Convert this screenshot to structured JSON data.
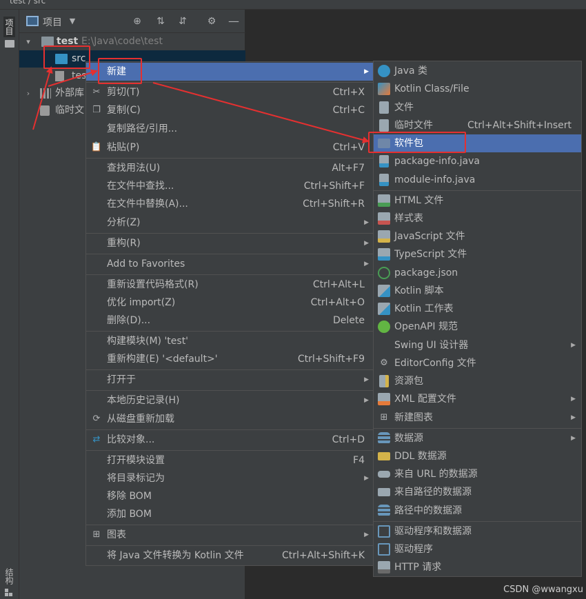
{
  "breadcrumb": {
    "project": "test",
    "folder": "src"
  },
  "left_strip": {
    "project_tab": "项目",
    "structure_tab": "结构"
  },
  "project_panel": {
    "title": "项目",
    "tree": {
      "root": {
        "name": "test",
        "path": "E:\\Java\\code\\test"
      },
      "src": "src",
      "iml": "tes",
      "external_libs": "外部库",
      "scratches": "临时文"
    }
  },
  "context_menu": [
    {
      "label": "新建",
      "shortcut": "",
      "submenu": true,
      "highlighted": true
    },
    {
      "label": "剪切(T)",
      "shortcut": "Ctrl+X",
      "icon": "scissors-icon"
    },
    {
      "label": "复制(C)",
      "shortcut": "Ctrl+C",
      "icon": "copy-icon"
    },
    {
      "label": "复制路径/引用...",
      "shortcut": ""
    },
    {
      "label": "粘贴(P)",
      "shortcut": "Ctrl+V",
      "icon": "paste-icon"
    },
    {
      "label": "查找用法(U)",
      "shortcut": "Alt+F7"
    },
    {
      "label": "在文件中查找...",
      "shortcut": "Ctrl+Shift+F"
    },
    {
      "label": "在文件中替换(A)...",
      "shortcut": "Ctrl+Shift+R"
    },
    {
      "label": "分析(Z)",
      "shortcut": "",
      "submenu": true
    },
    {
      "label": "重构(R)",
      "shortcut": "",
      "submenu": true
    },
    {
      "label": "Add to Favorites",
      "shortcut": "",
      "submenu": true
    },
    {
      "label": "重新设置代码格式(R)",
      "shortcut": "Ctrl+Alt+L"
    },
    {
      "label": "优化 import(Z)",
      "shortcut": "Ctrl+Alt+O"
    },
    {
      "label": "删除(D)...",
      "shortcut": "Delete"
    },
    {
      "label": "构建模块(M) 'test'",
      "shortcut": ""
    },
    {
      "label": "重新构建(E) '<default>'",
      "shortcut": "Ctrl+Shift+F9"
    },
    {
      "label": "打开于",
      "shortcut": "",
      "submenu": true
    },
    {
      "label": "本地历史记录(H)",
      "shortcut": "",
      "submenu": true
    },
    {
      "label": "从磁盘重新加载",
      "shortcut": "",
      "icon": "reload-icon"
    },
    {
      "label": "比较对象...",
      "shortcut": "Ctrl+D",
      "icon": "compare-icon"
    },
    {
      "label": "打开模块设置",
      "shortcut": "F4"
    },
    {
      "label": "将目录标记为",
      "shortcut": "",
      "submenu": true
    },
    {
      "label": "移除 BOM",
      "shortcut": ""
    },
    {
      "label": "添加 BOM",
      "shortcut": ""
    },
    {
      "label": "图表",
      "shortcut": "",
      "submenu": true,
      "icon": "diagram-icon"
    },
    {
      "label": "将 Java 文件转换为 Kotlin 文件",
      "shortcut": "Ctrl+Alt+Shift+K"
    }
  ],
  "new_submenu": [
    {
      "label": "Java 类",
      "icon": "java-class-icon"
    },
    {
      "label": "Kotlin Class/File",
      "icon": "kotlin-class-icon"
    },
    {
      "label": "文件",
      "icon": "file-icon"
    },
    {
      "label": "临时文件",
      "shortcut": "Ctrl+Alt+Shift+Insert",
      "icon": "scratch-file-icon"
    },
    {
      "label": "软件包",
      "highlighted": true,
      "icon": "package-icon"
    },
    {
      "label": "package-info.java",
      "icon": "java-file-icon"
    },
    {
      "label": "module-info.java",
      "icon": "java-file-icon"
    },
    {
      "label": "HTML 文件",
      "icon": "html-icon"
    },
    {
      "label": "样式表",
      "icon": "css-icon"
    },
    {
      "label": "JavaScript 文件",
      "icon": "js-icon"
    },
    {
      "label": "TypeScript 文件",
      "icon": "ts-icon"
    },
    {
      "label": "package.json",
      "icon": "nodejs-icon"
    },
    {
      "label": "Kotlin 脚本",
      "icon": "kotlin-script-icon"
    },
    {
      "label": "Kotlin 工作表",
      "icon": "kotlin-worksheet-icon"
    },
    {
      "label": "OpenAPI 规范",
      "icon": "openapi-icon"
    },
    {
      "label": "Swing UI 设计器",
      "submenu": true
    },
    {
      "label": "EditorConfig 文件",
      "icon": "gear-icon"
    },
    {
      "label": "资源包",
      "icon": "resource-bundle-icon"
    },
    {
      "label": "XML 配置文件",
      "submenu": true,
      "icon": "xml-icon"
    },
    {
      "label": "新建图表",
      "submenu": true,
      "icon": "diagram-icon"
    },
    {
      "label": "数据源",
      "submenu": true,
      "icon": "database-icon"
    },
    {
      "label": "DDL 数据源",
      "icon": "ddl-icon"
    },
    {
      "label": "来自 URL 的数据源",
      "icon": "url-datasource-icon"
    },
    {
      "label": "来自路径的数据源",
      "icon": "folder-icon"
    },
    {
      "label": "路径中的数据源",
      "icon": "database-icon"
    },
    {
      "label": "驱动程序和数据源",
      "icon": "driver-icon"
    },
    {
      "label": "驱动程序",
      "icon": "driver-icon"
    },
    {
      "label": "HTTP 请求",
      "icon": "api-icon"
    }
  ],
  "watermark": "CSDN @wwangxu",
  "colors": {
    "highlight": "#4b6eaf",
    "annotation": "#e53030",
    "menu_bg": "#3c3f41"
  }
}
